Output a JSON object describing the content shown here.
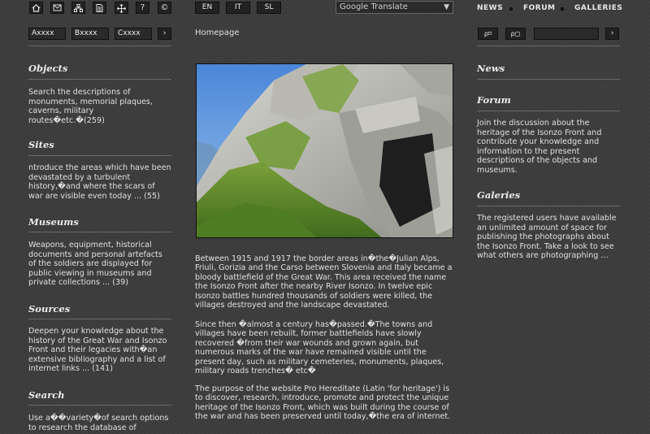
{
  "toolbar": {
    "icons": [
      "home-icon",
      "mail-icon",
      "sitemap-icon",
      "document-icon",
      "move-icon",
      "help-icon",
      "copyright-icon"
    ],
    "help_glyph": "?",
    "copyright_glyph": "©"
  },
  "languages": [
    "EN",
    "IT",
    "SL"
  ],
  "translate": {
    "label": "Google Translate"
  },
  "nav": [
    "NEWS",
    "FORUM",
    "GALLERIES"
  ],
  "fields": {
    "a": "Axxxx",
    "b": "Bxxxx",
    "c": "Cxxxx",
    "go": "›"
  },
  "breadcrumb": "Homepage",
  "search": {
    "btn1": "⍴⌑",
    "btn2": "⍴◻",
    "go": "›"
  },
  "left": [
    {
      "title": "Objects",
      "text": "Search the descriptions of monuments, memorial plaques, caverns, military routes�etc.�(259)"
    },
    {
      "title": "Sites",
      "text": "ntroduce the areas which have been devastated by a turbulent history,�and where the scars of war are visible even today ... (55)"
    },
    {
      "title": "Museums",
      "text": "Weapons, equipment, historical documents and personal artefacts of the soldiers are displayed for public viewing in museums and private collections ... (39)"
    },
    {
      "title": "Sources",
      "text": "Deepen your knowledge about the history of the Great War and Isonzo Front and their legacies with�an extensive bibliography and a list of internet links ... (141)"
    },
    {
      "title": "Search",
      "text": "Use a��variety�of search options to research the database of"
    }
  ],
  "main": {
    "p1": "Between 1915 and 1917 the border areas in�the�Julian Alps, Friuli, Gorizia and the Carso between Slovenia and Italy became a bloody battlefield of the Great War. This area received the name the Isonzo Front after the nearby River Isonzo. In twelve epic Isonzo battles hundred thousands of soldiers were killed, the villages destroyed and the landscape devastated.",
    "p2": "Since then �almost a century has�passed.�The towns and villages have been rebuilt, former battlefields have slowly recovered �from their war wounds and grown again, but numerous marks of the war have remained visible until the present day, such as military cemeteries, monuments, plaques, military roads trenches� etc�",
    "p3": "The purpose of the website Pro Hereditate (Latin 'for heritage') is to discover, research, introduce, promote and protect the unique heritage of the Isonzo Front, which was built during the course of the war and has been preserved until today,�the era of internet."
  },
  "right": [
    {
      "title": "News",
      "text": ""
    },
    {
      "title": "Forum",
      "text": "Join the discussion about the heritage of the Isonzo Front and contribute your knowledge and information to the present descriptions of the objects and museums."
    },
    {
      "title": "Galeries",
      "text": "The registered users have available an unlimited amount of space for publishing the photographs about the Isonzo Front. Take a look to see what others are photographing ..."
    }
  ]
}
